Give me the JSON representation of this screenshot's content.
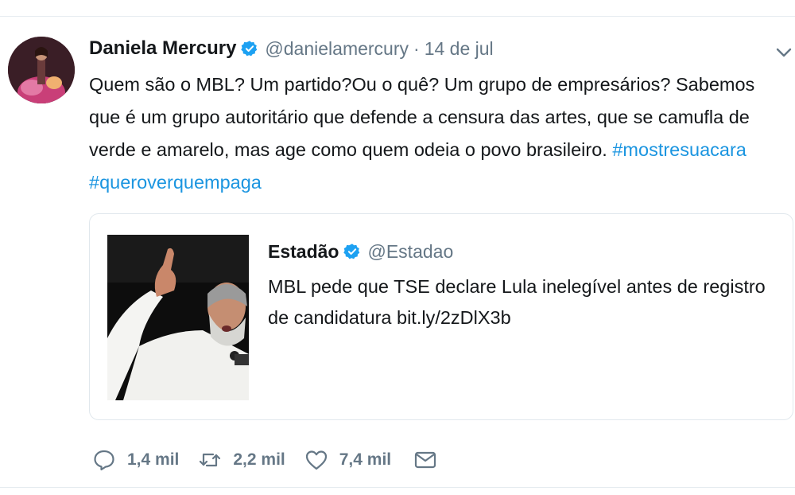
{
  "tweet": {
    "author_name": "Daniela Mercury",
    "handle": "@danielamercury",
    "separator": "·",
    "date": "14 de jul",
    "text": "Quem são o MBL? Um partido?Ou o quê? Um grupo de empresários?  Sabemos que é um grupo autoritário que defende a censura das artes, que se camufla de verde e amarelo, mas age como quem odeia o povo brasileiro.",
    "hashtags": [
      "#mostresuacara",
      "#queroverquempaga"
    ]
  },
  "quoted": {
    "author_name": "Estadão",
    "handle": "@Estadao",
    "text": "MBL pede que TSE declare Lula inelegível antes de registro de candidatura  bit.ly/2zDlX3b"
  },
  "actions": {
    "replies": "1,4 mil",
    "retweets": "2,2 mil",
    "likes": "7,4 mil"
  },
  "icons": {
    "reply": "reply-icon",
    "retweet": "retweet-icon",
    "like": "heart-icon",
    "dm": "mail-icon",
    "menu": "chevron-down-icon",
    "verified": "verified-badge-icon"
  },
  "colors": {
    "link": "#1b95e0",
    "verified": "#1da1f2",
    "muted": "#657786",
    "text": "#14171a"
  }
}
